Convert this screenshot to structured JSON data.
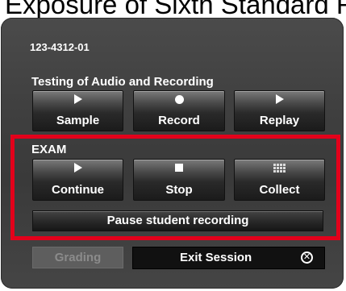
{
  "header_fragment": "Exposure of Sixth Standard Reading",
  "session": {
    "id": "123-4312-01"
  },
  "testing": {
    "title": "Testing of Audio and Recording",
    "buttons": [
      {
        "label": "Sample",
        "icon": "play-icon"
      },
      {
        "label": "Record",
        "icon": "record-icon"
      },
      {
        "label": "Replay",
        "icon": "play-icon"
      }
    ]
  },
  "exam": {
    "title": "EXAM",
    "buttons": [
      {
        "label": "Continue",
        "icon": "play-icon"
      },
      {
        "label": "Stop",
        "icon": "stop-icon"
      },
      {
        "label": "Collect",
        "icon": "collect-icon"
      }
    ],
    "pause_label": "Pause student recording"
  },
  "footer": {
    "grading_label": "Grading",
    "exit_label": "Exit Session",
    "exit_icon": "close-circle-icon"
  },
  "colors": {
    "highlight": "#e3001b",
    "panel": "#3f3f3f"
  }
}
